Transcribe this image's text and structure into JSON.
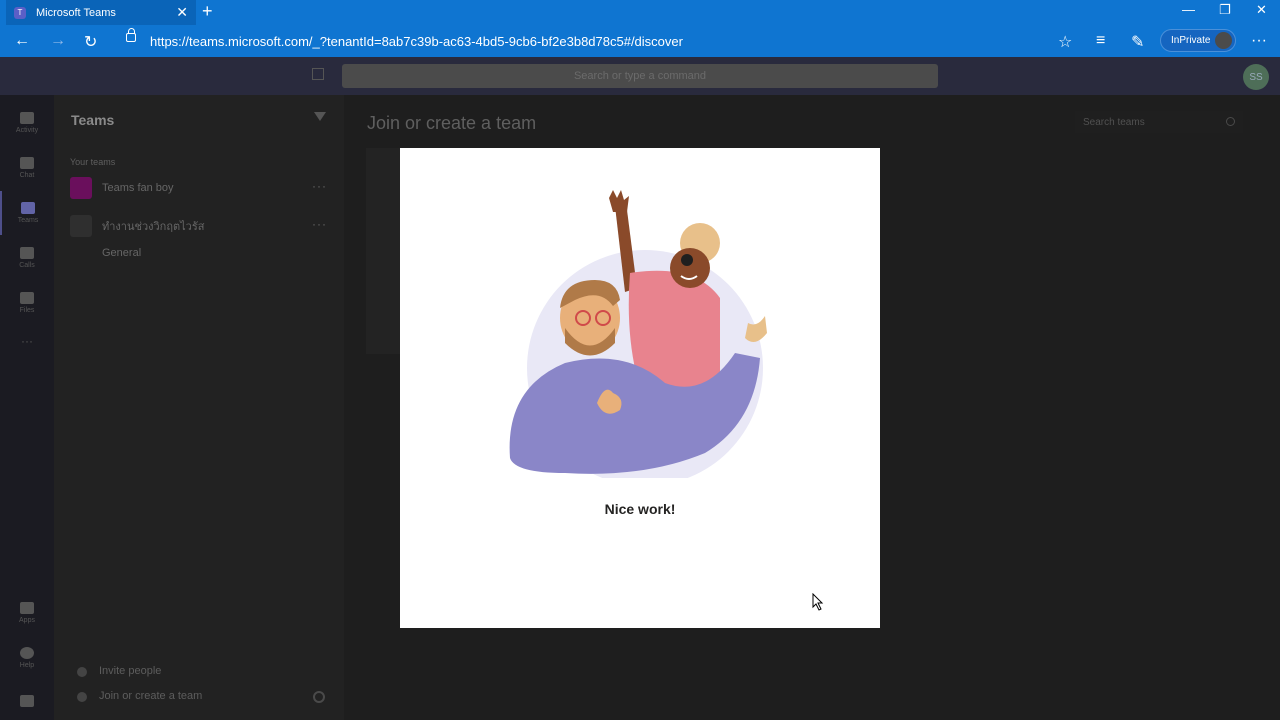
{
  "browser": {
    "tab_title": "Microsoft Teams",
    "url": "https://teams.microsoft.com/_?tenantId=8ab7c39b-ac63-4bd5-9cb6-bf2e3b8d78c5#/discover",
    "inprivate_label": "InPrivate"
  },
  "teams": {
    "search_placeholder": "Search or type a command",
    "user_initials": "SS",
    "rail": [
      {
        "label": "Activity"
      },
      {
        "label": "Chat"
      },
      {
        "label": "Teams"
      },
      {
        "label": "Calls"
      },
      {
        "label": "Files"
      },
      {
        "label": "Apps"
      },
      {
        "label": "Help"
      }
    ],
    "panel": {
      "title": "Teams",
      "section_label": "Your teams",
      "teams": [
        {
          "name": "Teams fan boy",
          "color": "#b4009e"
        },
        {
          "name": "ทำงานช่วงวิกฤตไวรัส",
          "color": "#3b3b3b",
          "channel": "General"
        }
      ],
      "invite_label": "Invite people",
      "join_create_label": "Join or create a team"
    },
    "main": {
      "title": "Join or create a team",
      "search_teams_placeholder": "Search teams"
    },
    "dialog": {
      "message": "Nice work!"
    }
  }
}
